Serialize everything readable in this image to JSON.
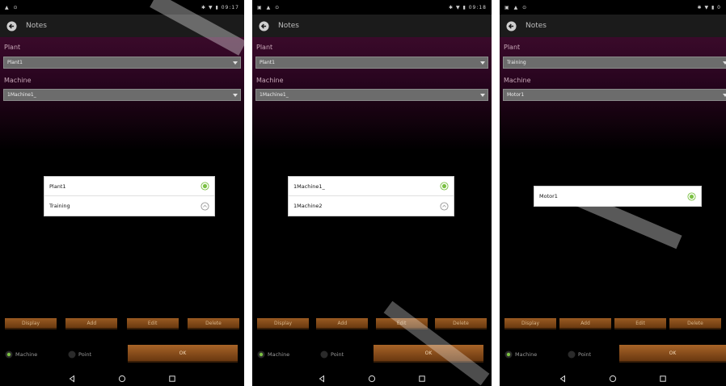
{
  "screens": [
    {
      "status": {
        "left": "▲ ⊙",
        "right": "✱ ▼ ▮ 09:17"
      },
      "app_title": "Notes",
      "plant_label": "Plant",
      "plant_value": "Plant1",
      "machine_label": "Machine",
      "machine_value": "1Machine1_",
      "dialog_options": [
        {
          "label": "Plant1",
          "selected": true
        },
        {
          "label": "Training",
          "selected": false
        }
      ],
      "buttons": {
        "display": "Display",
        "add": "Add",
        "edit": "Edit",
        "delete": "Delete"
      },
      "radio_machine": "Machine",
      "radio_point": "Point",
      "ok": "OK"
    },
    {
      "status": {
        "left": "▣ ▲ ⊙",
        "right": "✱ ▼ ▮ 09:18"
      },
      "app_title": "Notes",
      "plant_label": "Plant",
      "plant_value": "Plant1",
      "machine_label": "Machine",
      "machine_value": "1Machine1_",
      "dialog_options": [
        {
          "label": "1Machine1_",
          "selected": true
        },
        {
          "label": "1Machine2",
          "selected": false
        }
      ],
      "buttons": {
        "display": "Display",
        "add": "Add",
        "edit": "Edit",
        "delete": "Delete"
      },
      "radio_machine": "Machine",
      "radio_point": "Point",
      "ok": "OK"
    },
    {
      "status": {
        "left": "▣ ▲ ⊙",
        "right": "✱ ▼ ▮ 0"
      },
      "app_title": "Notes",
      "plant_label": "Plant",
      "plant_value": "Training",
      "machine_label": "Machine",
      "machine_value": "Motor1",
      "dialog_options": [
        {
          "label": "Motor1",
          "selected": true
        }
      ],
      "buttons": {
        "display": "Display",
        "add": "Add",
        "edit": "Edit",
        "delete": "Delete"
      },
      "radio_machine": "Machine",
      "radio_point": "Point",
      "ok": "OK"
    }
  ],
  "colors": {
    "accent_green": "#7bc043",
    "button_brown": "#8a4e1c",
    "form_purple": "#3a0a2a"
  },
  "icons": [
    "back-arrow-icon",
    "dropdown-arrow-icon",
    "radio-icon",
    "nav-back-icon",
    "nav-home-icon",
    "nav-recents-icon"
  ]
}
